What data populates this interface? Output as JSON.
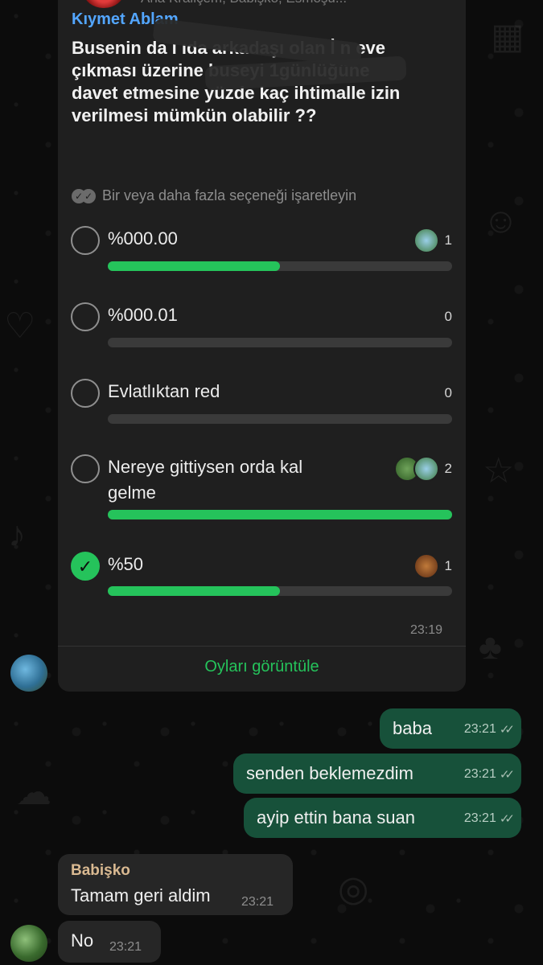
{
  "header": {
    "members_text": "Ana Kraliçem, Babişko, Esmoşu..."
  },
  "poll": {
    "sender": "Kıymet Ablam",
    "question": "Busenin da                 ı ıda arkadaşı olan İ                            n eve çıkması üzerine buseyi 1günlüğüne davet etmesine yüzde kaç ihtimalle izin verilmesi mümkün olabilir ??",
    "hint": "Bir veya daha fazla seçeneği işaretleyin",
    "options": [
      {
        "label": "%000.00",
        "count": "1",
        "fraction": 0.5,
        "checked": false
      },
      {
        "label": "%000.01",
        "count": "0",
        "fraction": 0,
        "checked": false
      },
      {
        "label": "Evlatlıktan red",
        "count": "0",
        "fraction": 0,
        "checked": false
      },
      {
        "label": "Nereye gittiysen orda kal gelme",
        "count": "2",
        "fraction": 1,
        "checked": false
      },
      {
        "label": "%50",
        "count": "1",
        "fraction": 0.5,
        "checked": true
      }
    ],
    "time": "23:19",
    "view_votes": "Oyları görüntüle"
  },
  "messages_out": [
    {
      "text": "baba",
      "time": "23:21"
    },
    {
      "text": "senden beklemezdim",
      "time": "23:21"
    },
    {
      "text": "ayip ettin bana suan",
      "time": "23:21"
    }
  ],
  "messages_in": [
    {
      "sender": "Babişko",
      "text": "Tamam geri aldim",
      "time": "23:21"
    },
    {
      "text": "No",
      "time": "23:21"
    }
  ],
  "colors": {
    "accent_green": "#25c35b",
    "outgoing_bubble": "#17513a",
    "incoming_bubble": "#262626",
    "sender_blue": "#53a6ff",
    "sender_tan": "#d9b991"
  },
  "icons": [
    "double-check-icon",
    "radio-empty-icon",
    "radio-checked-icon",
    "read-ticks-icon"
  ]
}
